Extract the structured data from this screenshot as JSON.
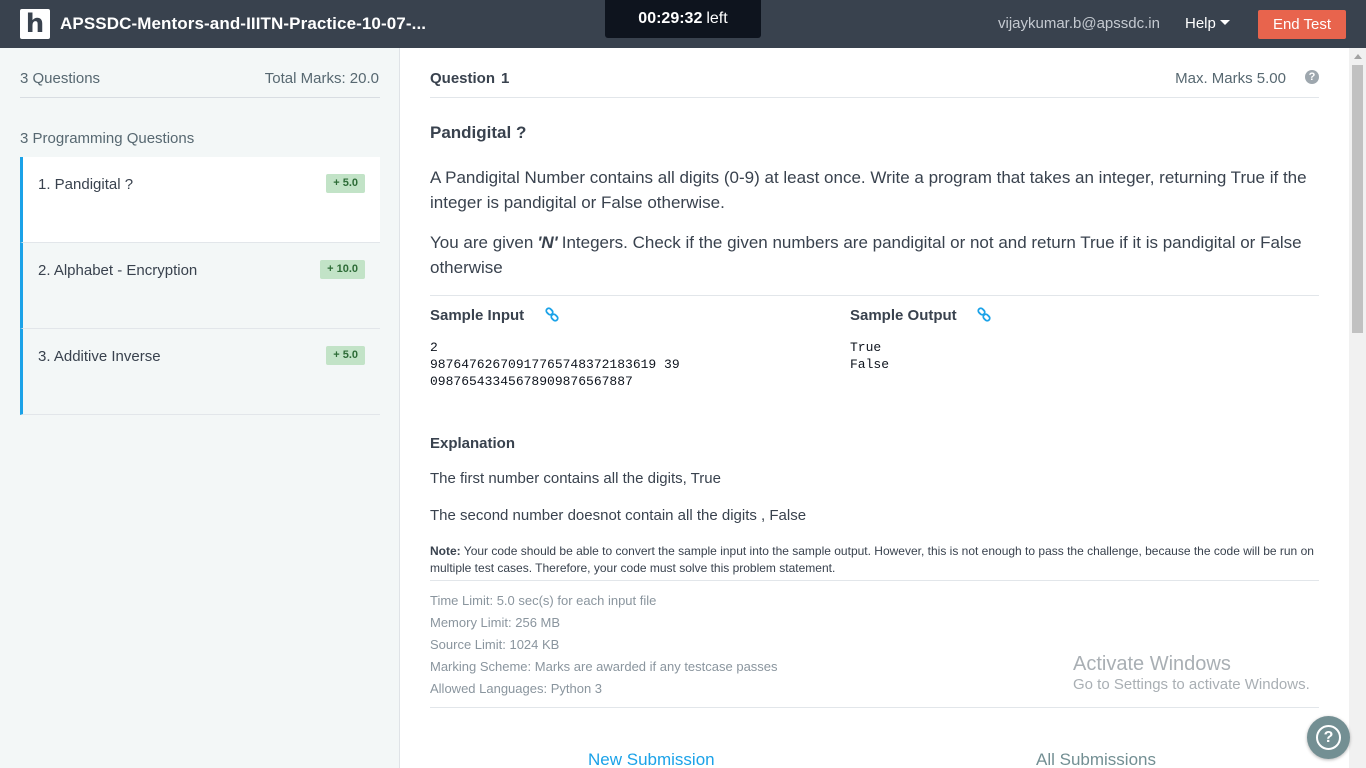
{
  "header": {
    "logo_letter": "h",
    "title": "APSSDC-Mentors-and-IIITN-Practice-10-07-...",
    "timer_value": "00:29:32",
    "timer_suffix": "left",
    "user_email": "vijaykumar.b@apssdc.in",
    "help_label": "Help",
    "end_test_label": "End Test"
  },
  "sidebar": {
    "question_count": "3 Questions",
    "total_marks": "Total Marks: 20.0",
    "section_title": "3 Programming Questions",
    "questions": [
      {
        "label": "1. Pandigital ?",
        "badge": "+ 5.0",
        "active": true
      },
      {
        "label": "2. Alphabet - Encryption",
        "badge": "+ 10.0",
        "active": false
      },
      {
        "label": "3. Additive Inverse",
        "badge": "+ 5.0",
        "active": false
      }
    ]
  },
  "main": {
    "question_label": "Question",
    "question_number": "1",
    "max_marks": "Max. Marks 5.00",
    "help_icon_glyph": "?",
    "problem_title": "Pandigital ?",
    "description_1": "A Pandigital Number contains all digits (0-9) at least once. Write a program that takes an integer, returning True if the integer is pandigital or False otherwise.",
    "description_2_prefix": "You are given",
    "description_2_emphasis": "'N'",
    "description_2_suffix": "Integers. Check if the given numbers are pandigital or not and return True if it is pandigital or False otherwise",
    "sample_input_label": "Sample Input",
    "sample_output_label": "Sample Output",
    "sample_input": "2\n98764762670917765748372183619 39\n09876543345678909876567887",
    "sample_output": "True\nFalse",
    "explanation_label": "Explanation",
    "explanation_lines": [
      "The first number contains all the digits, True",
      "The second number doesnot contain all the digits , False"
    ],
    "note_label": "Note:",
    "note_text": "Your code should be able to convert the sample input into the sample output. However, this is not enough to pass the challenge, because the code will be run on multiple test cases. Therefore, your code must solve this problem statement.",
    "limits": [
      "Time Limit: 5.0 sec(s) for each input file",
      "Memory Limit: 256 MB",
      "Source Limit: 1024 KB",
      "Marking Scheme: Marks are awarded if any testcase passes",
      "Allowed Languages: Python 3"
    ],
    "tab_new_submission": "New Submission",
    "tab_all_submissions": "All Submissions"
  },
  "watermark": {
    "title": "Activate Windows",
    "subtitle": "Go to Settings to activate Windows."
  },
  "floating_help_glyph": "?",
  "colors": {
    "header_bg": "#39424e",
    "timer_bg": "#0e141e",
    "end_test_bg": "#e8644d",
    "accent": "#1ba2e8",
    "badge_bg": "#c2e3c7",
    "sidebar_bg": "#f3f7f7"
  },
  "icons": {
    "link": "link-icon",
    "help": "question-circle-icon",
    "caret": "caret-down-icon"
  }
}
